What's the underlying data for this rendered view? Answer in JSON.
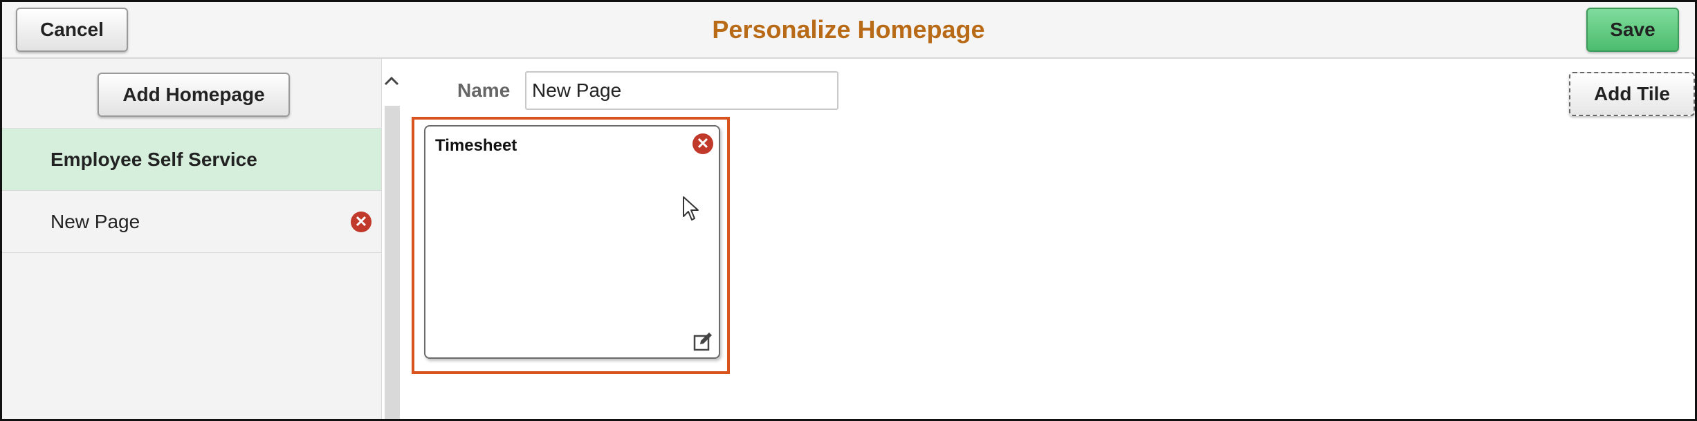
{
  "header": {
    "cancel_label": "Cancel",
    "title": "Personalize Homepage",
    "save_label": "Save"
  },
  "sidebar": {
    "add_homepage_label": "Add Homepage",
    "items": [
      {
        "label": "Employee Self Service",
        "active": true,
        "removable": false
      },
      {
        "label": "New Page",
        "active": false,
        "removable": true
      }
    ]
  },
  "main": {
    "name_label": "Name",
    "name_value": "New Page",
    "add_tile_label": "Add Tile",
    "tiles": [
      {
        "title": "Timesheet"
      }
    ]
  },
  "icons": {
    "remove": "remove-icon",
    "edit": "edit-icon",
    "scroll_up": "chevron-up-icon",
    "cursor": "mouse-pointer-icon"
  },
  "colors": {
    "title": "#b86a16",
    "save_button": "#4cbc6e",
    "active_item": "#d6efdc",
    "remove_icon": "#c0392b",
    "tile_highlight": "#d9531e"
  }
}
